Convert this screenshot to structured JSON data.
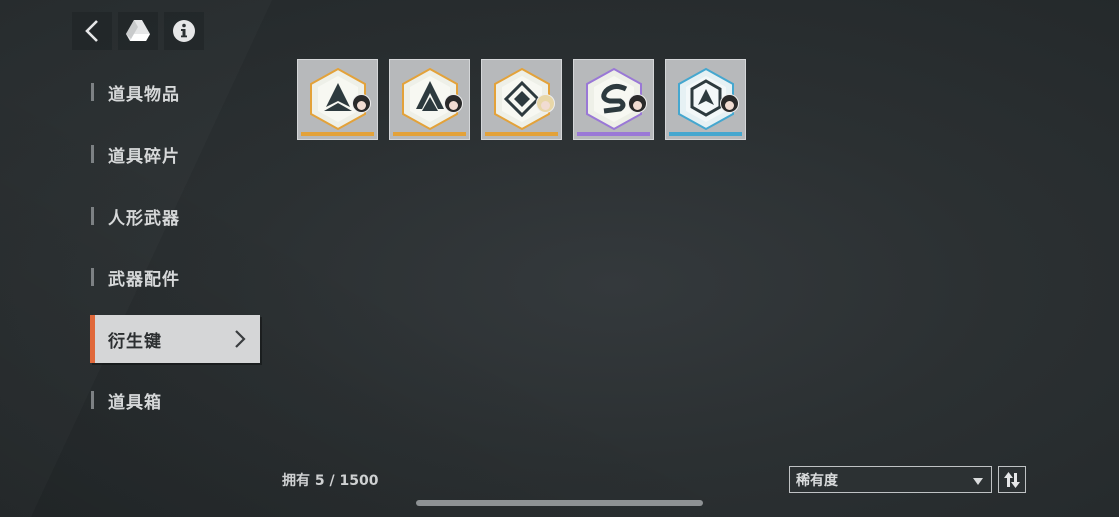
{
  "toolbar": {
    "back_icon": "chevron-left-icon",
    "drive_icon": "triangle-logo-icon",
    "info_icon": "info-icon"
  },
  "sidebar": {
    "items": [
      {
        "label": "道具物品",
        "active": false
      },
      {
        "label": "道具碎片",
        "active": false
      },
      {
        "label": "人形武器",
        "active": false
      },
      {
        "label": "武器配件",
        "active": false
      },
      {
        "label": "衍生键",
        "active": true
      },
      {
        "label": "道具箱",
        "active": false
      }
    ]
  },
  "inventory": {
    "items": [
      {
        "emblem": "tri-peak-emblem-icon",
        "rarity_color": "#e3a23a",
        "avatar": "dark-hair"
      },
      {
        "emblem": "double-peak-emblem-icon",
        "rarity_color": "#e3a23a",
        "avatar": "dark-hair"
      },
      {
        "emblem": "diamond-emblem-icon",
        "rarity_color": "#e3a23a",
        "avatar": "blond-hair"
      },
      {
        "emblem": "s-swirl-emblem-icon",
        "rarity_color": "#9a78d6",
        "avatar": "dark-hair"
      },
      {
        "emblem": "shield-peak-emblem-icon",
        "rarity_color": "#45a7cf",
        "avatar": "dark-hair"
      }
    ]
  },
  "footer": {
    "count_text": "拥有 5 / 1500",
    "sort_label": "稀有度",
    "order_icon": "sort-order-icon"
  },
  "colors": {
    "accent": "#e0683a",
    "gold": "#e3a23a",
    "purple": "#9a78d6",
    "blue": "#45a7cf"
  }
}
